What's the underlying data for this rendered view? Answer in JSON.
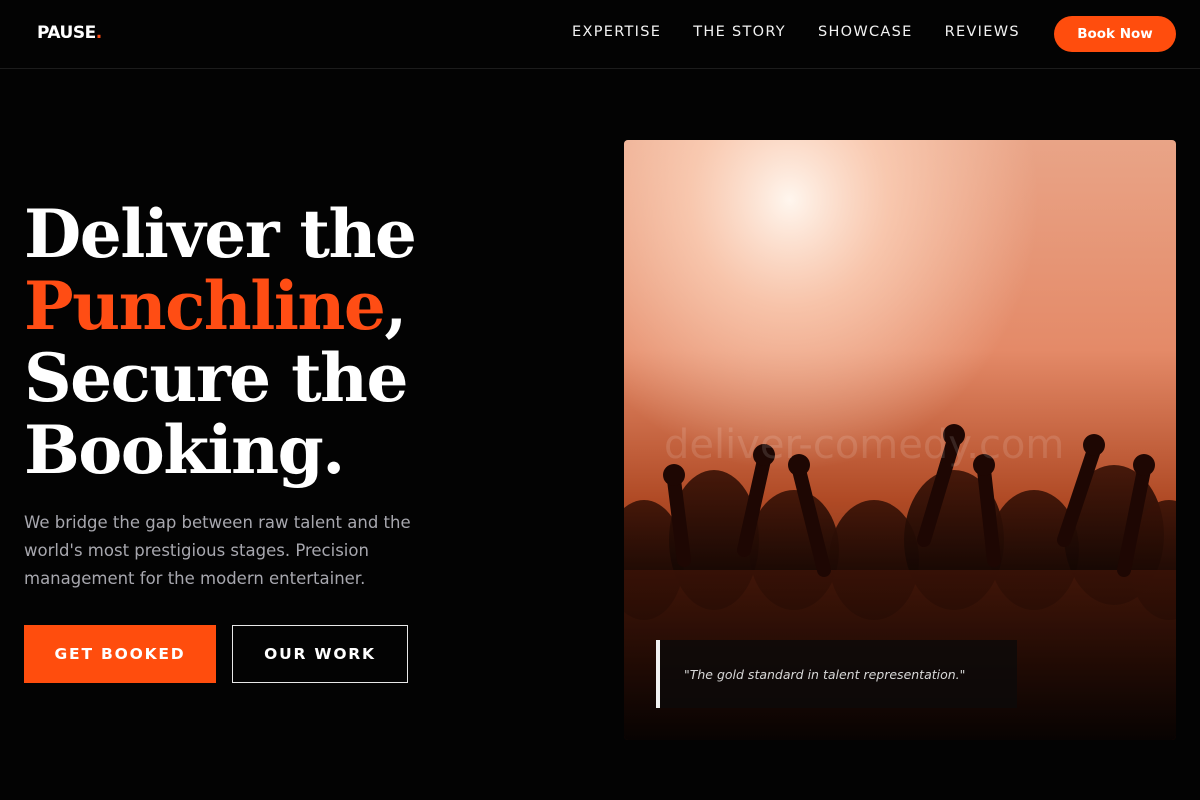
{
  "brand": {
    "name": "PAUSE",
    "dot": "."
  },
  "nav": {
    "items": [
      {
        "label": "EXPERTISE"
      },
      {
        "label": "THE STORY"
      },
      {
        "label": "SHOWCASE"
      },
      {
        "label": "REVIEWS"
      }
    ],
    "cta_label": "Book Now"
  },
  "hero": {
    "headline": {
      "line1": "Deliver the",
      "accent": "Punchline",
      "accent_suffix": ",",
      "line3": "Secure the",
      "line4": "Booking."
    },
    "subcopy": "We bridge the gap between raw talent and the world's most prestigious stages. Precision management for the modern entertainer.",
    "primary_button": "GET BOOKED",
    "secondary_button": "OUR WORK",
    "image": {
      "subject": "concert crowd with raised hands under stage lights",
      "watermark": "deliver-comedy.com"
    },
    "quote": "\"The gold standard in talent representation.\""
  },
  "colors": {
    "accent": "#ff4d14",
    "background": "#030303",
    "text": "#ffffff",
    "muted_text": "#a7a7ae"
  }
}
